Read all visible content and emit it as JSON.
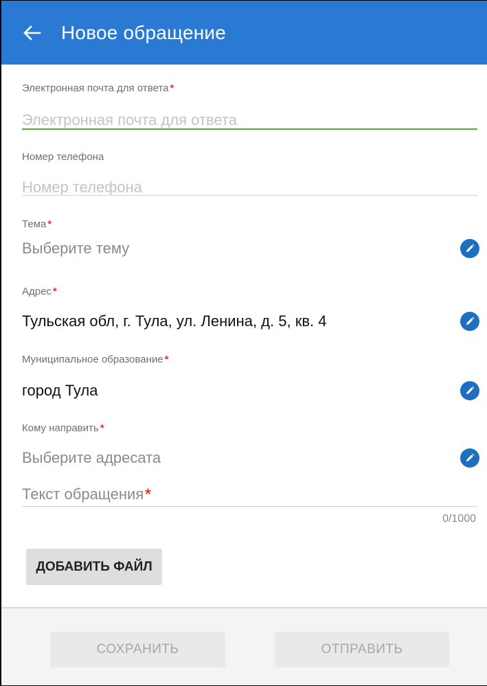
{
  "app_bar": {
    "title": "Новое обращение",
    "back_icon": "arrow-left-icon",
    "color": "#2a7ad4"
  },
  "form": {
    "email": {
      "label": "Электронная почта для ответа",
      "required_mark": "*",
      "placeholder": "Электронная почта для ответа",
      "value": ""
    },
    "phone": {
      "label": "Номер телефона",
      "placeholder": "Номер телефона",
      "value": ""
    },
    "topic": {
      "label": "Тема",
      "required_mark": "*",
      "value": "Выберите тему",
      "icon": "edit-icon"
    },
    "address": {
      "label": "Адрес",
      "required_mark": "*",
      "value": "Тульская обл, г. Тула, ул. Ленина, д. 5, кв. 4",
      "icon": "edit-icon"
    },
    "municipality": {
      "label": "Муниципальное образование",
      "required_mark": "*",
      "value": "город Тула",
      "icon": "edit-icon"
    },
    "recipient": {
      "label": "Кому направить",
      "required_mark": "*",
      "value": "Выберите адресата",
      "icon": "edit-icon"
    },
    "message": {
      "placeholder": "Текст обращения",
      "required_mark": "*",
      "counter": "0/1000"
    },
    "add_file_label": "ДОБАВИТЬ ФАЙЛ"
  },
  "footer": {
    "save_label": "СОХРАНИТЬ",
    "send_label": "ОТПРАВИТЬ"
  }
}
